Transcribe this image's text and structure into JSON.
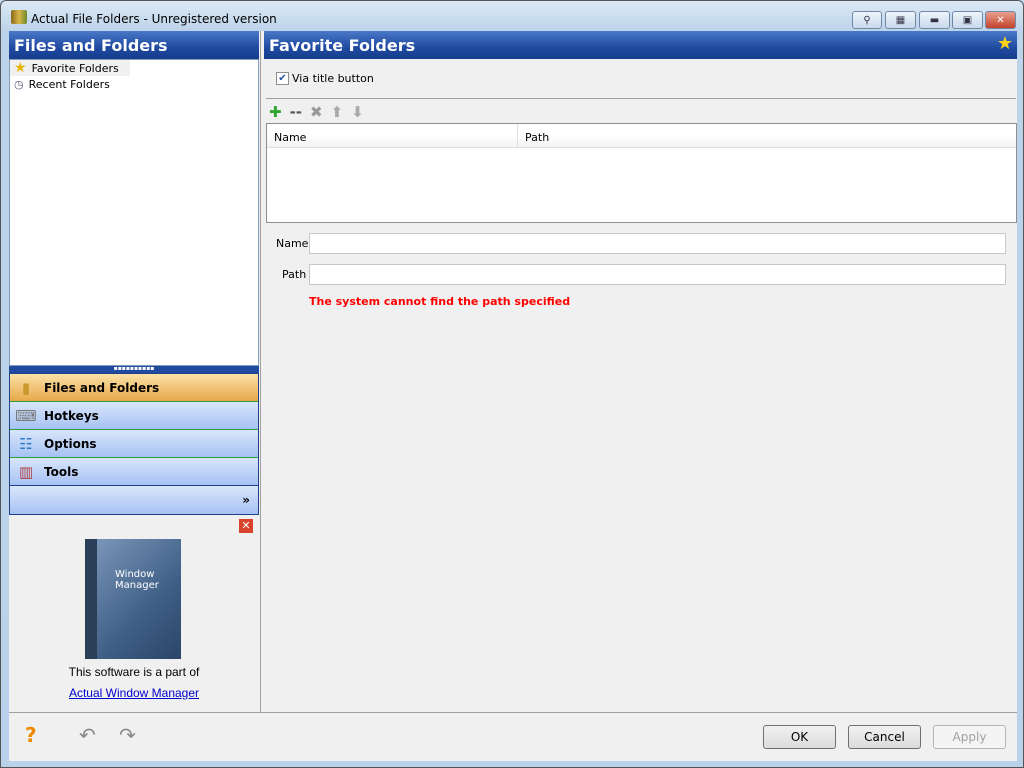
{
  "window": {
    "title": "Actual File Folders - Unregistered version",
    "controls": [
      "pin",
      "transparency",
      "minimize",
      "maximize",
      "close"
    ]
  },
  "left": {
    "header": "Files and Folders",
    "tree": [
      {
        "label": "Favorite Folders",
        "icon": "star-icon"
      },
      {
        "label": "Recent Folders",
        "icon": "clock-icon"
      }
    ],
    "nav": [
      {
        "label": "Files and Folders",
        "selected": true
      },
      {
        "label": "Hotkeys"
      },
      {
        "label": "Options"
      },
      {
        "label": "Tools"
      }
    ],
    "ad": {
      "text": "This software is a part of",
      "link": "Actual Window Manager",
      "box_title": "Window Manager"
    }
  },
  "right": {
    "header": "Favorite Folders",
    "checkbox_label": "Via title button",
    "checkbox_checked": true,
    "columns": [
      "Name",
      "Path"
    ],
    "name_label": "Name",
    "name_value": "",
    "path_label": "Path",
    "path_value": "",
    "error": "The system cannot find the path specified",
    "error_color": "#ff0000"
  },
  "footer": {
    "ok": "OK",
    "cancel": "Cancel",
    "apply": "Apply"
  }
}
